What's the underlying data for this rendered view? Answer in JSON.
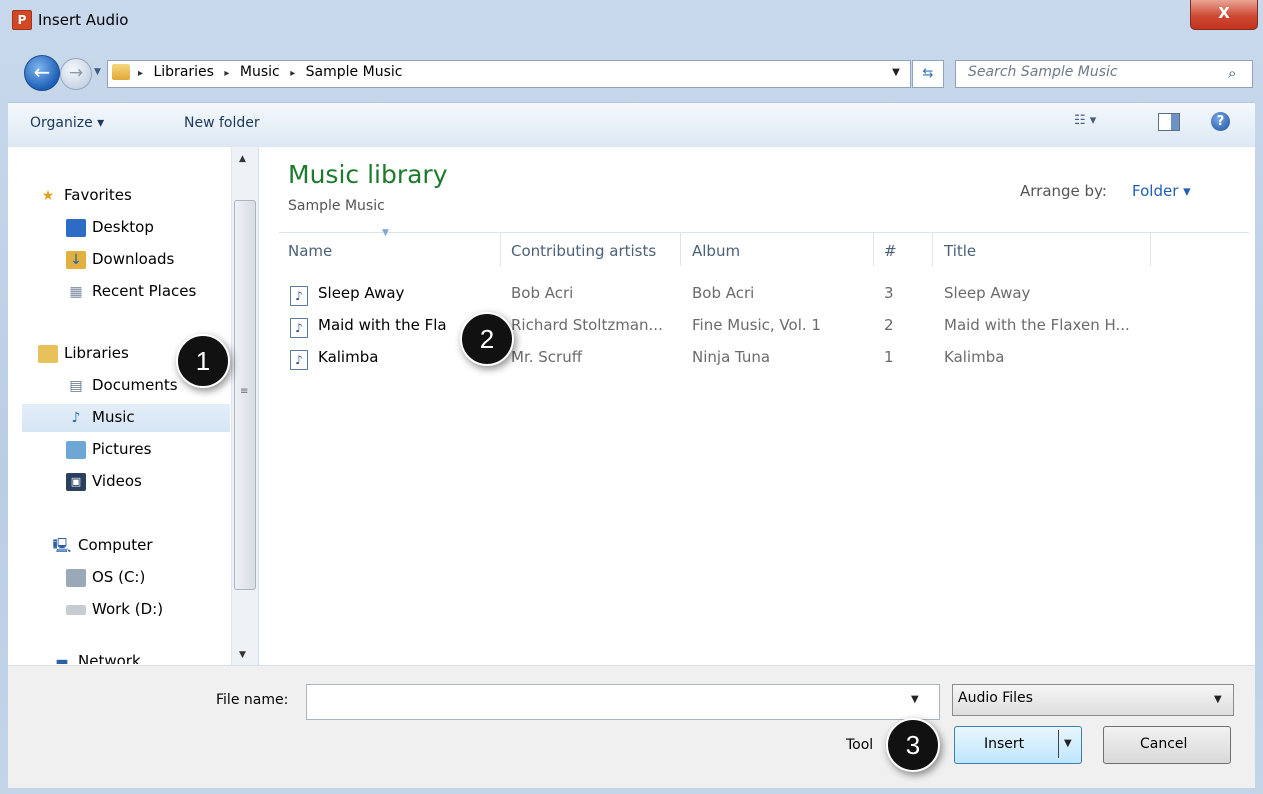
{
  "window": {
    "title": "Insert Audio",
    "app_icon_letter": "P",
    "close_glyph": "X"
  },
  "address": {
    "crumbs": [
      "Libraries",
      "Music",
      "Sample Music"
    ],
    "separator": "▸",
    "search_placeholder": "Search Sample Music"
  },
  "toolbar": {
    "organize": "Organize ▾",
    "new_folder": "New folder"
  },
  "nav": {
    "favorites": "Favorites",
    "desktop": "Desktop",
    "downloads": "Downloads",
    "recent_places": "Recent Places",
    "libraries": "Libraries",
    "documents": "Documents",
    "music": "Music",
    "pictures": "Pictures",
    "videos": "Videos",
    "computer": "Computer",
    "os_c": "OS (C:)",
    "work_d": "Work (D:)",
    "network": "Network"
  },
  "library": {
    "title": "Music library",
    "subtitle": "Sample Music",
    "arrange_label": "Arrange by:",
    "arrange_value": "Folder ▾"
  },
  "columns": [
    "Name",
    "Contributing artists",
    "Album",
    "#",
    "Title"
  ],
  "rows": [
    {
      "name": "Sleep Away",
      "artist": "Bob Acri",
      "album": "Bob Acri",
      "num": "3",
      "title": "Sleep Away"
    },
    {
      "name": "Maid with the Fla",
      "artist": "Richard Stoltzman...",
      "album": "Fine Music, Vol. 1",
      "num": "2",
      "title": "Maid with the Flaxen H..."
    },
    {
      "name": "Kalimba",
      "artist": "Mr. Scruff",
      "album": "Ninja Tuna",
      "num": "1",
      "title": "Kalimba"
    }
  ],
  "bottom": {
    "file_name_label": "File name:",
    "file_name_value": "",
    "file_type": "Audio Files",
    "tools": "Tool",
    "insert": "Insert",
    "cancel": "Cancel"
  },
  "callouts": [
    "1",
    "2",
    "3"
  ],
  "colors": {
    "library_title": "#1e7a2e",
    "link": "#1f5fb4",
    "close": "#c4321c"
  }
}
